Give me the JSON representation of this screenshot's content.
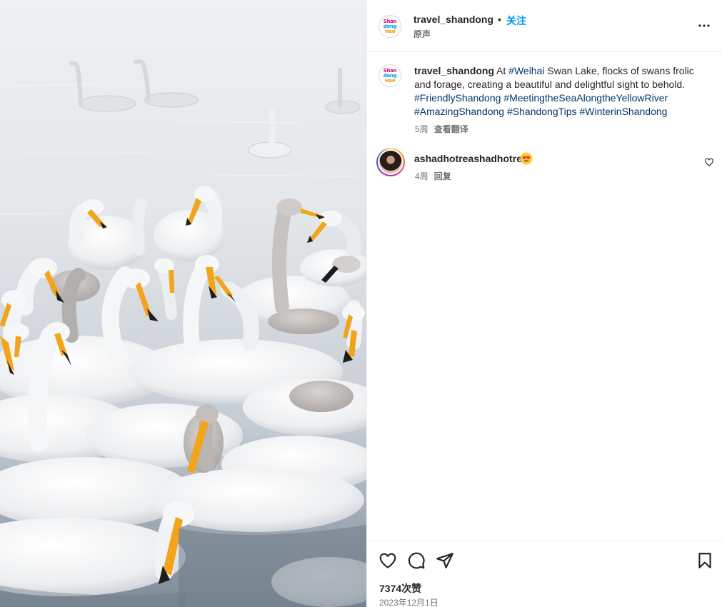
{
  "post": {
    "username": "travel_shandong",
    "separator": "•",
    "follow_label": "关注",
    "audio_label": "原声",
    "more_icon": "more-horizontal-icon",
    "logo_text": [
      "Shan",
      "dong",
      "Hao"
    ]
  },
  "caption": {
    "username": "travel_shandong",
    "text_1": "At ",
    "tag_1": "#Weihai",
    "text_2": " Swan Lake, flocks of swans frolic and forage, creating a beautiful and delightful sight to behold.",
    "tags": [
      "#FriendlyShandong",
      "#MeetingtheSeaAlongtheYellowRiver",
      "#AmazingShandong",
      "#ShandongTips",
      "#WinterinShandong"
    ],
    "age": "5周",
    "translate_label": "查看翻译"
  },
  "comment": {
    "username": "ashadhotreashadhotre",
    "emoji": "smiling-face-with-heart-eyes",
    "age": "4周",
    "reply_label": "回复"
  },
  "actions": {
    "likes": "7374次赞",
    "date": "2023年12月1日"
  },
  "colors": {
    "link_blue": "#0095f6",
    "hashtag": "#00376b",
    "secondary_text": "#737373",
    "divider": "#efefef",
    "beak_orange": "#f2a51a"
  }
}
